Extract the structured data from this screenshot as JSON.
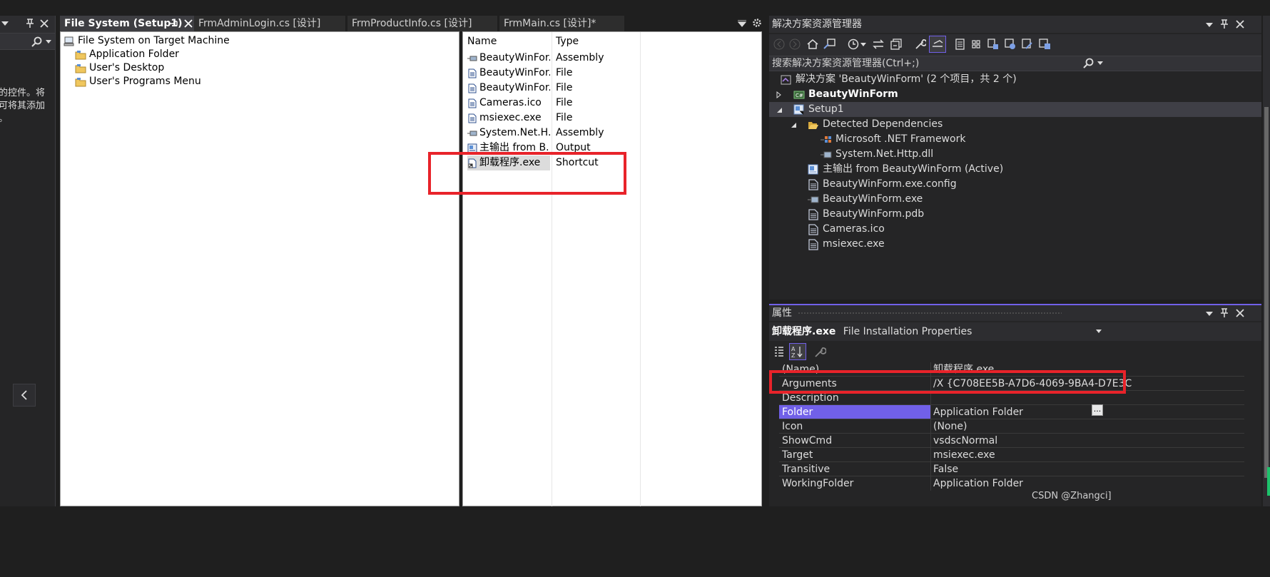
{
  "toolbox": {
    "description_lines": "的控件。将\n可将其添加\n。"
  },
  "tabs": [
    {
      "label": "File System (Setup1)",
      "active": true
    },
    {
      "label": "FrmAdminLogin.cs [设计]",
      "active": false
    },
    {
      "label": "FrmProductInfo.cs [设计]",
      "active": false
    },
    {
      "label": "FrmMain.cs [设计]*",
      "active": false
    }
  ],
  "filesystem": {
    "tree": [
      {
        "label": "File System on Target Machine",
        "icon": "computer-icon"
      },
      {
        "label": "Application Folder",
        "icon": "folder-icon"
      },
      {
        "label": "User's Desktop",
        "icon": "folder-icon"
      },
      {
        "label": "User's Programs Menu",
        "icon": "folder-icon"
      }
    ],
    "list_columns": [
      "Name",
      "Type"
    ],
    "list_rows": [
      {
        "name": "BeautyWinFor...",
        "type": "Assembly",
        "icon": "assembly-icon"
      },
      {
        "name": "BeautyWinFor...",
        "type": "File",
        "icon": "file-icon"
      },
      {
        "name": "BeautyWinFor...",
        "type": "File",
        "icon": "file-icon"
      },
      {
        "name": "Cameras.ico",
        "type": "File",
        "icon": "file-icon"
      },
      {
        "name": "msiexec.exe",
        "type": "File",
        "icon": "file-icon"
      },
      {
        "name": "System.Net.H...",
        "type": "Assembly",
        "icon": "assembly-icon"
      },
      {
        "name": "主输出 from B...",
        "type": "Output",
        "icon": "output-icon"
      },
      {
        "name": "卸载程序.exe",
        "type": "Shortcut",
        "icon": "shortcut-icon",
        "selected": true
      }
    ]
  },
  "solution_explorer": {
    "title": "解决方案资源管理器",
    "search_placeholder": "搜索解决方案资源管理器(Ctrl+;)",
    "items": [
      {
        "label": "解决方案 'BeautyWinForm' (2 个项目，共 2 个)",
        "icon": "solution-icon"
      },
      {
        "label": "BeautyWinForm",
        "icon": "csharp-project-icon",
        "bold": true
      },
      {
        "label": "Setup1",
        "icon": "setup-project-icon"
      },
      {
        "label": "Detected Dependencies",
        "icon": "folder-open-icon"
      },
      {
        "label": "Microsoft .NET Framework",
        "icon": "framework-icon"
      },
      {
        "label": "System.Net.Http.dll",
        "icon": "assembly-icon"
      },
      {
        "label": "主输出 from BeautyWinForm (Active)",
        "icon": "output-icon"
      },
      {
        "label": "BeautyWinForm.exe.config",
        "icon": "file-icon"
      },
      {
        "label": "BeautyWinForm.exe",
        "icon": "assembly-icon"
      },
      {
        "label": "BeautyWinForm.pdb",
        "icon": "file-icon"
      },
      {
        "label": "Cameras.ico",
        "icon": "file-icon"
      },
      {
        "label": "msiexec.exe",
        "icon": "file-icon"
      }
    ]
  },
  "properties": {
    "title": "属性",
    "object_name": "卸载程序.exe",
    "object_type": "File Installation Properties",
    "rows": [
      {
        "name": "(Name)",
        "value": "卸载程序.exe"
      },
      {
        "name": "Arguments",
        "value": "/X {C708EE5B-A7D6-4069-9BA4-D7E3C"
      },
      {
        "name": "Description",
        "value": ""
      },
      {
        "name": "Folder",
        "value": "Application Folder",
        "selected": true
      },
      {
        "name": "Icon",
        "value": "(None)"
      },
      {
        "name": "ShowCmd",
        "value": "vsdscNormal"
      },
      {
        "name": "Target",
        "value": "msiexec.exe"
      },
      {
        "name": "Transitive",
        "value": "False"
      },
      {
        "name": "WorkingFolder",
        "value": "Application Folder"
      }
    ],
    "ellipsis_label": "..."
  },
  "watermark": "CSDN @Zhangci]",
  "colors": {
    "accent": "#7160e8",
    "highlight_box": "#e8232a"
  }
}
